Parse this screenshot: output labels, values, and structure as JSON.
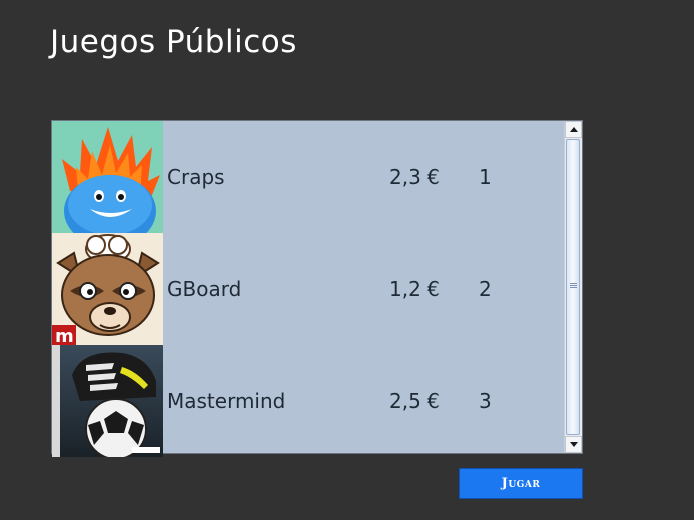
{
  "page": {
    "title": "Juegos Públicos"
  },
  "games": [
    {
      "name": "Craps",
      "price": "2,3 €",
      "rank": "1",
      "icon": "blue-monster-icon"
    },
    {
      "name": "GBoard",
      "price": "1,2 €",
      "rank": "2",
      "icon": "raccoon-chef-icon"
    },
    {
      "name": "Mastermind",
      "price": "2,5 €",
      "rank": "3",
      "icon": "soccer-boot-ball-icon"
    }
  ],
  "actions": {
    "play_label": "Jugar"
  },
  "colors": {
    "background": "#323232",
    "list_background": "#b3c3d5",
    "button": "#1b78f0"
  }
}
